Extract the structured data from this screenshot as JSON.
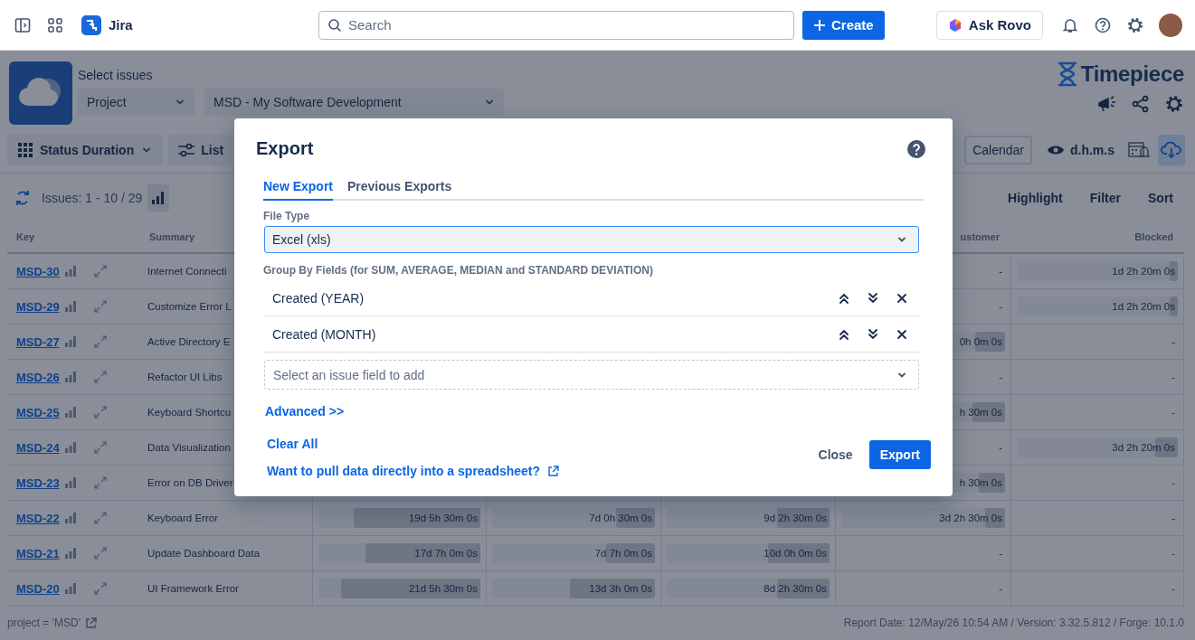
{
  "top_bar": {
    "app_name": "Jira",
    "search": {
      "placeholder": "Search"
    },
    "create_button": "Create",
    "rovo_button": "Ask Rovo"
  },
  "header": {
    "select_label": "Select issues",
    "scope_dropdown": "Project",
    "project_dropdown": "MSD - My Software Development",
    "brand": "Timepiece"
  },
  "toolbar": {
    "report_dropdown": "Status Duration",
    "list_button": "List",
    "calendar_button": "Calendar",
    "format_toggle": "d.h.m.s",
    "icon_buttons": [
      {
        "kind": "calendar-alert",
        "selected": false
      },
      {
        "kind": "download",
        "selected": true
      }
    ]
  },
  "issues_bar": {
    "count": "Issues: 1 - 10 / 29",
    "actions": [
      "Highlight",
      "Filter",
      "Sort"
    ]
  },
  "table": {
    "columns": {
      "key": "Key",
      "summary": "Summary",
      "column_6": "ustomer",
      "blocked": "Blocked"
    },
    "rows": [
      {
        "key": "MSD-30",
        "summary": "Internet Connecti",
        "column_6": {
          "text": "-"
        },
        "blocked": {
          "text": "1d 2h 20m 0s",
          "level": 0.05
        }
      },
      {
        "key": "MSD-29",
        "summary": "Customize Error L",
        "column_6": {
          "text": "-"
        },
        "blocked": {
          "text": "1d 2h 20m 0s",
          "level": 0.05
        }
      },
      {
        "key": "MSD-27",
        "summary": "Active Directory E",
        "column_6": {
          "text": "0h 0m 0s",
          "level": 0.18
        },
        "blocked": {
          "text": "-"
        }
      },
      {
        "key": "MSD-26",
        "summary": "Refactor UI Libs",
        "column_6": {
          "text": "-"
        },
        "blocked": {
          "text": "-"
        }
      },
      {
        "key": "MSD-25",
        "summary": "Keyboard Shortcu",
        "column_6": {
          "text": "h 30m 0s",
          "level": 0.2
        },
        "blocked": {
          "text": "-"
        }
      },
      {
        "key": "MSD-24",
        "summary": "Data Visualization",
        "column_6": {
          "text": "-"
        },
        "blocked": {
          "text": "3d 2h 20m 0s",
          "level": 0.14
        }
      },
      {
        "key": "MSD-23",
        "summary": "Error on DB Driver",
        "column_6": {
          "text": "h 30m 0s",
          "level": 0.16
        },
        "blocked": {
          "text": "-"
        }
      },
      {
        "key": "MSD-22",
        "summary": "Keyboard Error",
        "column_3": {
          "text": "19d 5h 30m 0s",
          "level": 0.78
        },
        "column_4": {
          "text": "7d 0h 30m 0s",
          "level": 0.24
        },
        "column_5": {
          "text": "9d 2h 30m 0s",
          "level": 0.32
        },
        "column_6": {
          "text": "3d 2h 30m 0s",
          "level": 0.12
        },
        "blocked": {
          "text": "-"
        }
      },
      {
        "key": "MSD-21",
        "summary": "Update Dashboard Data",
        "column_3": {
          "text": "17d 7h 0m 0s",
          "level": 0.71
        },
        "column_4": {
          "text": "7d 7h 0m 0s",
          "level": 0.3
        },
        "column_5": {
          "text": "10d 0h 0m 0s",
          "level": 0.38
        },
        "column_6": {
          "text": "-"
        },
        "blocked": {
          "text": "-"
        }
      },
      {
        "key": "MSD-20",
        "summary": "UI Framework Error",
        "column_3": {
          "text": "21d 5h 30m 0s",
          "level": 0.86
        },
        "column_4": {
          "text": "13d 3h 0m 0s",
          "level": 0.52
        },
        "column_5": {
          "text": "8d 2h 30m 0s",
          "level": 0.32
        },
        "column_6": {
          "text": "-"
        },
        "blocked": {
          "text": "-"
        }
      }
    ]
  },
  "footer": {
    "query": "project = 'MSD'",
    "info": "Report Date: 12/May/26 10:54 AM / Version: 3.32.5.812 / Forge: 10.1.0"
  },
  "modal": {
    "title": "Export",
    "tabs": [
      {
        "label": "New Export",
        "selected": true
      },
      {
        "label": "Previous Exports",
        "selected": false
      }
    ],
    "file_type": {
      "label": "File Type",
      "value": "Excel (xls)"
    },
    "group_by": {
      "label": "Group By Fields (for SUM, AVERAGE, MEDIAN and STANDARD DEVIATION)",
      "fields": [
        "Created (YEAR)",
        "Created (MONTH)"
      ],
      "placeholder": "Select an issue field to add"
    },
    "advanced_link": "Advanced >>",
    "clear_link": "Clear All",
    "spreadsheet_link": "Want to pull data directly into a spreadsheet?",
    "buttons": {
      "close": "Close",
      "export": "Export"
    }
  }
}
